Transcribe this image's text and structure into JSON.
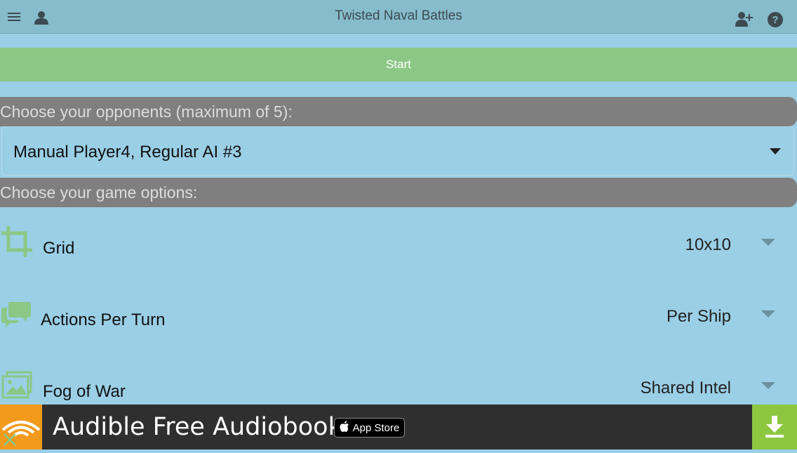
{
  "header": {
    "title": "Twisted Naval Battles",
    "icons": [
      "menu-icon",
      "profile-icon",
      "add-user-icon",
      "help-icon"
    ]
  },
  "start": {
    "label": "Start"
  },
  "opponents": {
    "heading": "Choose your opponents (maximum of 5):",
    "selected": "Manual Player4, Regular AI #3"
  },
  "options": {
    "heading": "Choose your game options:",
    "items": [
      {
        "label": "Grid",
        "value": "10x10",
        "icon": "crop-icon"
      },
      {
        "label": "Actions Per Turn",
        "value": "Per Ship",
        "icon": "chat-bubbles-icon"
      },
      {
        "label": "Fog of War",
        "value": "Shared Intel",
        "icon": "images-icon"
      }
    ]
  },
  "ad": {
    "text": "Audible Free Audiobook.",
    "store_label": "App Store",
    "icons": [
      "audible-logo-icon",
      "apple-icon",
      "download-icon",
      "close-icon"
    ]
  },
  "colors": {
    "background": "#9acfe6",
    "topbar": "#86bccc",
    "start": "#8bc785",
    "section": "#807f7f",
    "icon_green": "#8bc785",
    "ad_orange": "#f39a1d",
    "ad_green": "#8dc63f"
  }
}
